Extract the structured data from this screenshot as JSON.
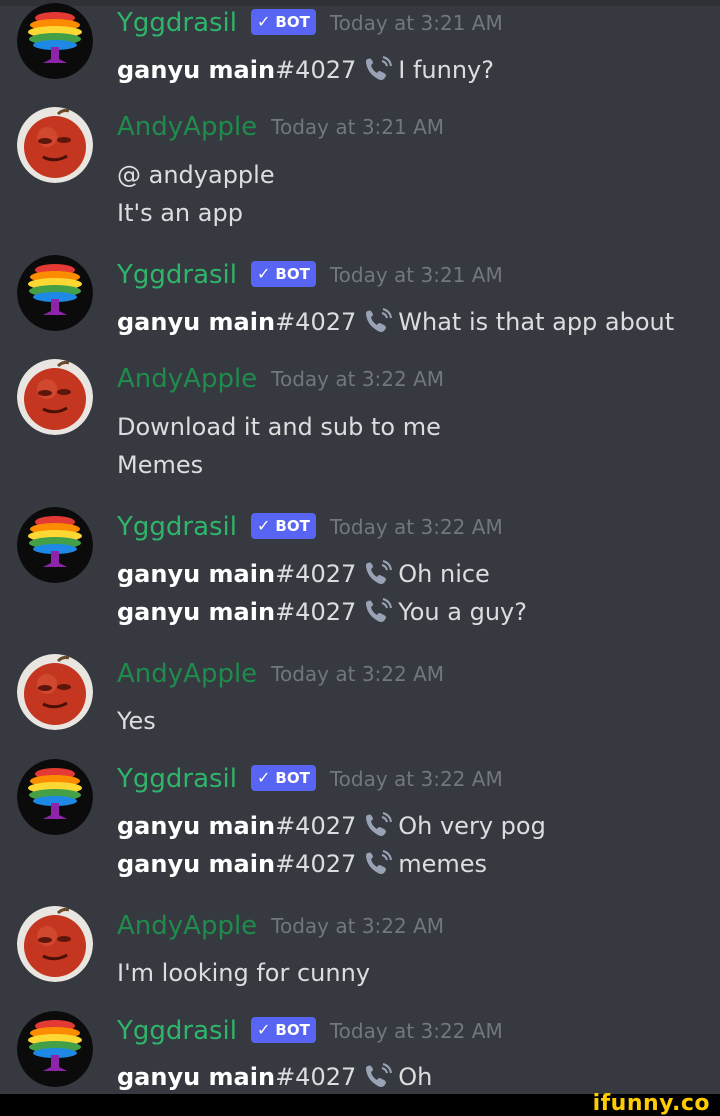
{
  "messages": [
    {
      "user": "Yggdrasil",
      "bot": true,
      "bot_label": "BOT",
      "time": "Today at 3:21 AM",
      "lines": [
        {
          "caller": "ganyu main",
          "tag": "#4027",
          "text": "I funny?"
        }
      ]
    },
    {
      "user": "AndyApple",
      "bot": false,
      "time": "Today at 3:21 AM",
      "lines": [
        {
          "text": "@ andyapple"
        },
        {
          "text": "It's an app"
        }
      ]
    },
    {
      "user": "Yggdrasil",
      "bot": true,
      "bot_label": "BOT",
      "time": "Today at 3:21 AM",
      "lines": [
        {
          "caller": "ganyu main",
          "tag": "#4027",
          "text": "What is that app about"
        }
      ]
    },
    {
      "user": "AndyApple",
      "bot": false,
      "time": "Today at 3:22 AM",
      "lines": [
        {
          "text": "Download it and sub to me"
        },
        {
          "text": "Memes"
        }
      ]
    },
    {
      "user": "Yggdrasil",
      "bot": true,
      "bot_label": "BOT",
      "time": "Today at 3:22 AM",
      "lines": [
        {
          "caller": "ganyu main",
          "tag": "#4027",
          "text": "Oh nice"
        },
        {
          "caller": "ganyu main",
          "tag": "#4027",
          "text": "You a guy?"
        }
      ]
    },
    {
      "user": "AndyApple",
      "bot": false,
      "time": "Today at 3:22 AM",
      "lines": [
        {
          "text": "Yes"
        }
      ]
    },
    {
      "user": "Yggdrasil",
      "bot": true,
      "bot_label": "BOT",
      "time": "Today at 3:22 AM",
      "lines": [
        {
          "caller": "ganyu main",
          "tag": "#4027",
          "text": "Oh very pog"
        },
        {
          "caller": "ganyu main",
          "tag": "#4027",
          "text": "memes"
        }
      ]
    },
    {
      "user": "AndyApple",
      "bot": false,
      "time": "Today at 3:22 AM",
      "lines": [
        {
          "text": "I'm looking for cunny"
        }
      ]
    },
    {
      "user": "Yggdrasil",
      "bot": true,
      "bot_label": "BOT",
      "time": "Today at 3:22 AM",
      "lines": [
        {
          "caller": "ganyu main",
          "tag": "#4027",
          "text": "Oh"
        }
      ]
    }
  ],
  "icons": {
    "bot_verified": "checkmark-icon",
    "phone": "phone-icon",
    "yggdrasil_avatar": "rainbow-tree-icon",
    "andy_avatar": "apple-face-avatar"
  },
  "colors": {
    "background": "#36393f",
    "bot_badge": "#5865f2",
    "yggdrasil_name": "#2fb56b",
    "andy_name": "#1f8b4c",
    "timestamp": "#72767d",
    "watermark": "#ffcc00"
  },
  "watermark": "ifunny.co"
}
